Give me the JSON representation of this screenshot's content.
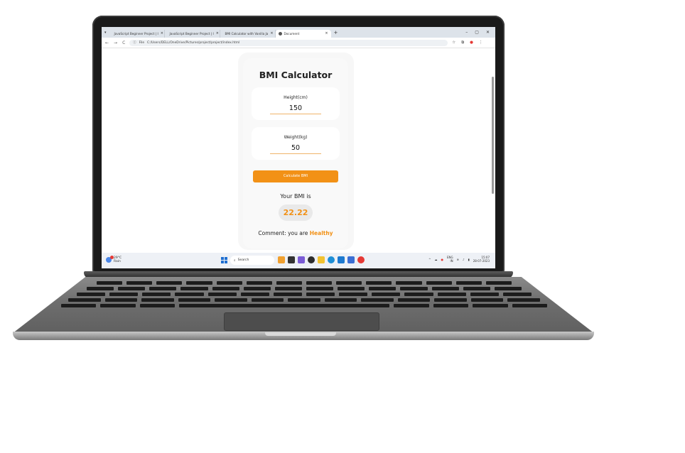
{
  "browser": {
    "tabs": [
      {
        "label": "JavaScript Beginner Project | I",
        "color": "#e53935",
        "active": false
      },
      {
        "label": "JavaScript Beginner Project | I",
        "color": "#e53935",
        "active": false
      },
      {
        "label": "BMI Calculator with Vanilla Ja",
        "color": "#555555",
        "active": false
      },
      {
        "label": "Document",
        "color": "#555555",
        "active": true
      }
    ],
    "new_tab": "+",
    "close_glyph": "×",
    "window_controls": {
      "minimize": "–",
      "maximize": "▢",
      "close": "✕"
    },
    "nav": {
      "back": "←",
      "forward": "→",
      "reload": "C"
    },
    "address": {
      "scheme": "File",
      "url": "C:/Users/DELL/OneDrive/Pictures/project/project/index.html"
    }
  },
  "app": {
    "title": "BMI Calculator",
    "height": {
      "label": "Height(cm)",
      "value": "150"
    },
    "weight": {
      "label": "Weight(kg)",
      "value": "50"
    },
    "button_label": "Calculate BMI",
    "result_label": "Your BMI is",
    "bmi_value": "22.22",
    "comment_prefix": "Comment: you are",
    "comment_state": "Healthy",
    "accent_color": "#f29116"
  },
  "taskbar": {
    "weather_temp": "29°C",
    "weather_desc": "Rain",
    "search_label": "Search",
    "language": "ENG",
    "region": "IN",
    "time": "15:07",
    "date": "28-07-2023"
  }
}
